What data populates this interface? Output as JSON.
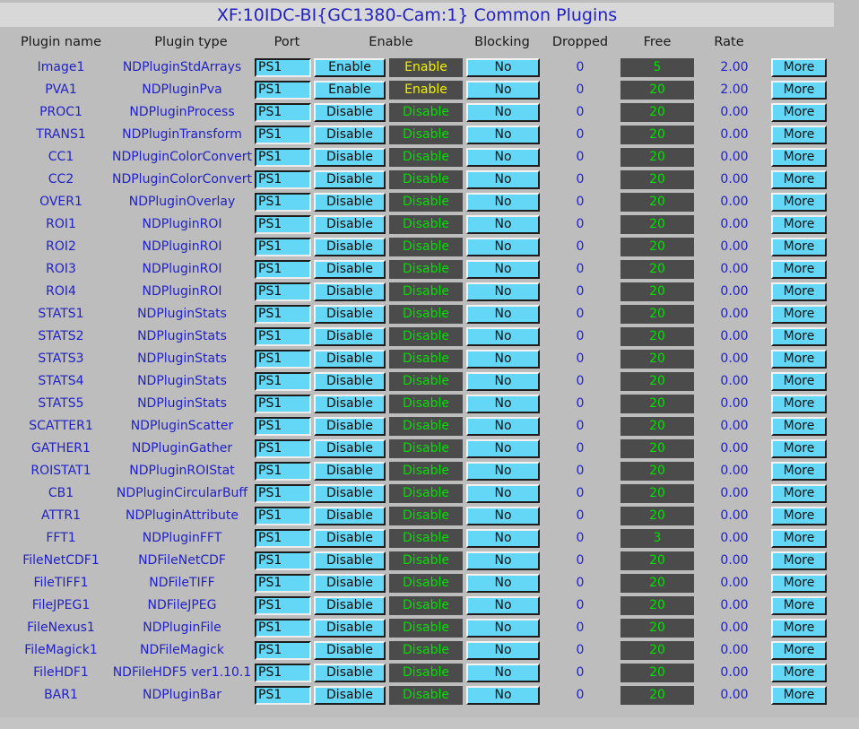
{
  "window": {
    "title": "XF:10IDC-BI{GC1380-Cam:1} Common Plugins",
    "bg_color": "#bdbdbd",
    "titlebar_color": "#d8d8d8",
    "title_color": "#2222c4"
  },
  "colors": {
    "label_blue": "#2222c4",
    "widget_cyan": "#63d7f5",
    "monitor_bg": "#4b4b4b",
    "monitor_green": "#00e000",
    "monitor_yellow": "#f2f200"
  },
  "table": {
    "headers": [
      "Plugin name",
      "Plugin type",
      "Port",
      "Enable",
      "Blocking",
      "Dropped",
      "Free",
      "Rate"
    ],
    "more_label": "More",
    "rows": [
      {
        "name": "Image1",
        "type": "NDPluginStdArrays",
        "port": "PS1",
        "enable_button": "Enable",
        "enable_readback": "Enable",
        "enable_state": "enabled",
        "blocking": "No",
        "dropped": "0",
        "free": "5",
        "rate": "2.00",
        "more": "More"
      },
      {
        "name": "PVA1",
        "type": "NDPluginPva",
        "port": "PS1",
        "enable_button": "Enable",
        "enable_readback": "Enable",
        "enable_state": "enabled",
        "blocking": "No",
        "dropped": "0",
        "free": "20",
        "rate": "2.00",
        "more": "More"
      },
      {
        "name": "PROC1",
        "type": "NDPluginProcess",
        "port": "PS1",
        "enable_button": "Disable",
        "enable_readback": "Disable",
        "enable_state": "disabled",
        "blocking": "No",
        "dropped": "0",
        "free": "20",
        "rate": "0.00",
        "more": "More"
      },
      {
        "name": "TRANS1",
        "type": "NDPluginTransform",
        "port": "PS1",
        "enable_button": "Disable",
        "enable_readback": "Disable",
        "enable_state": "disabled",
        "blocking": "No",
        "dropped": "0",
        "free": "20",
        "rate": "0.00",
        "more": "More"
      },
      {
        "name": "CC1",
        "type": "NDPluginColorConvert",
        "port": "PS1",
        "enable_button": "Disable",
        "enable_readback": "Disable",
        "enable_state": "disabled",
        "blocking": "No",
        "dropped": "0",
        "free": "20",
        "rate": "0.00",
        "more": "More"
      },
      {
        "name": "CC2",
        "type": "NDPluginColorConvert",
        "port": "PS1",
        "enable_button": "Disable",
        "enable_readback": "Disable",
        "enable_state": "disabled",
        "blocking": "No",
        "dropped": "0",
        "free": "20",
        "rate": "0.00",
        "more": "More"
      },
      {
        "name": "OVER1",
        "type": "NDPluginOverlay",
        "port": "PS1",
        "enable_button": "Disable",
        "enable_readback": "Disable",
        "enable_state": "disabled",
        "blocking": "No",
        "dropped": "0",
        "free": "20",
        "rate": "0.00",
        "more": "More"
      },
      {
        "name": "ROI1",
        "type": "NDPluginROI",
        "port": "PS1",
        "enable_button": "Disable",
        "enable_readback": "Disable",
        "enable_state": "disabled",
        "blocking": "No",
        "dropped": "0",
        "free": "20",
        "rate": "0.00",
        "more": "More"
      },
      {
        "name": "ROI2",
        "type": "NDPluginROI",
        "port": "PS1",
        "enable_button": "Disable",
        "enable_readback": "Disable",
        "enable_state": "disabled",
        "blocking": "No",
        "dropped": "0",
        "free": "20",
        "rate": "0.00",
        "more": "More"
      },
      {
        "name": "ROI3",
        "type": "NDPluginROI",
        "port": "PS1",
        "enable_button": "Disable",
        "enable_readback": "Disable",
        "enable_state": "disabled",
        "blocking": "No",
        "dropped": "0",
        "free": "20",
        "rate": "0.00",
        "more": "More"
      },
      {
        "name": "ROI4",
        "type": "NDPluginROI",
        "port": "PS1",
        "enable_button": "Disable",
        "enable_readback": "Disable",
        "enable_state": "disabled",
        "blocking": "No",
        "dropped": "0",
        "free": "20",
        "rate": "0.00",
        "more": "More"
      },
      {
        "name": "STATS1",
        "type": "NDPluginStats",
        "port": "PS1",
        "enable_button": "Disable",
        "enable_readback": "Disable",
        "enable_state": "disabled",
        "blocking": "No",
        "dropped": "0",
        "free": "20",
        "rate": "0.00",
        "more": "More"
      },
      {
        "name": "STATS2",
        "type": "NDPluginStats",
        "port": "PS1",
        "enable_button": "Disable",
        "enable_readback": "Disable",
        "enable_state": "disabled",
        "blocking": "No",
        "dropped": "0",
        "free": "20",
        "rate": "0.00",
        "more": "More"
      },
      {
        "name": "STATS3",
        "type": "NDPluginStats",
        "port": "PS1",
        "enable_button": "Disable",
        "enable_readback": "Disable",
        "enable_state": "disabled",
        "blocking": "No",
        "dropped": "0",
        "free": "20",
        "rate": "0.00",
        "more": "More"
      },
      {
        "name": "STATS4",
        "type": "NDPluginStats",
        "port": "PS1",
        "enable_button": "Disable",
        "enable_readback": "Disable",
        "enable_state": "disabled",
        "blocking": "No",
        "dropped": "0",
        "free": "20",
        "rate": "0.00",
        "more": "More"
      },
      {
        "name": "STATS5",
        "type": "NDPluginStats",
        "port": "PS1",
        "enable_button": "Disable",
        "enable_readback": "Disable",
        "enable_state": "disabled",
        "blocking": "No",
        "dropped": "0",
        "free": "20",
        "rate": "0.00",
        "more": "More"
      },
      {
        "name": "SCATTER1",
        "type": "NDPluginScatter",
        "port": "PS1",
        "enable_button": "Disable",
        "enable_readback": "Disable",
        "enable_state": "disabled",
        "blocking": "No",
        "dropped": "0",
        "free": "20",
        "rate": "0.00",
        "more": "More"
      },
      {
        "name": "GATHER1",
        "type": "NDPluginGather",
        "port": "PS1",
        "enable_button": "Disable",
        "enable_readback": "Disable",
        "enable_state": "disabled",
        "blocking": "No",
        "dropped": "0",
        "free": "20",
        "rate": "0.00",
        "more": "More"
      },
      {
        "name": "ROISTAT1",
        "type": "NDPluginROIStat",
        "port": "PS1",
        "enable_button": "Disable",
        "enable_readback": "Disable",
        "enable_state": "disabled",
        "blocking": "No",
        "dropped": "0",
        "free": "20",
        "rate": "0.00",
        "more": "More"
      },
      {
        "name": "CB1",
        "type": "NDPluginCircularBuff",
        "port": "PS1",
        "enable_button": "Disable",
        "enable_readback": "Disable",
        "enable_state": "disabled",
        "blocking": "No",
        "dropped": "0",
        "free": "20",
        "rate": "0.00",
        "more": "More"
      },
      {
        "name": "ATTR1",
        "type": "NDPluginAttribute",
        "port": "PS1",
        "enable_button": "Disable",
        "enable_readback": "Disable",
        "enable_state": "disabled",
        "blocking": "No",
        "dropped": "0",
        "free": "20",
        "rate": "0.00",
        "more": "More"
      },
      {
        "name": "FFT1",
        "type": "NDPluginFFT",
        "port": "PS1",
        "enable_button": "Disable",
        "enable_readback": "Disable",
        "enable_state": "disabled",
        "blocking": "No",
        "dropped": "0",
        "free": "3",
        "rate": "0.00",
        "more": "More"
      },
      {
        "name": "FileNetCDF1",
        "type": "NDFileNetCDF",
        "port": "PS1",
        "enable_button": "Disable",
        "enable_readback": "Disable",
        "enable_state": "disabled",
        "blocking": "No",
        "dropped": "0",
        "free": "20",
        "rate": "0.00",
        "more": "More"
      },
      {
        "name": "FileTIFF1",
        "type": "NDFileTIFF",
        "port": "PS1",
        "enable_button": "Disable",
        "enable_readback": "Disable",
        "enable_state": "disabled",
        "blocking": "No",
        "dropped": "0",
        "free": "20",
        "rate": "0.00",
        "more": "More"
      },
      {
        "name": "FileJPEG1",
        "type": "NDFileJPEG",
        "port": "PS1",
        "enable_button": "Disable",
        "enable_readback": "Disable",
        "enable_state": "disabled",
        "blocking": "No",
        "dropped": "0",
        "free": "20",
        "rate": "0.00",
        "more": "More"
      },
      {
        "name": "FileNexus1",
        "type": "NDPluginFile",
        "port": "PS1",
        "enable_button": "Disable",
        "enable_readback": "Disable",
        "enable_state": "disabled",
        "blocking": "No",
        "dropped": "0",
        "free": "20",
        "rate": "0.00",
        "more": "More"
      },
      {
        "name": "FileMagick1",
        "type": "NDFileMagick",
        "port": "PS1",
        "enable_button": "Disable",
        "enable_readback": "Disable",
        "enable_state": "disabled",
        "blocking": "No",
        "dropped": "0",
        "free": "20",
        "rate": "0.00",
        "more": "More"
      },
      {
        "name": "FileHDF1",
        "type": "NDFileHDF5 ver1.10.1",
        "port": "PS1",
        "enable_button": "Disable",
        "enable_readback": "Disable",
        "enable_state": "disabled",
        "blocking": "No",
        "dropped": "0",
        "free": "20",
        "rate": "0.00",
        "more": "More"
      },
      {
        "name": "BAR1",
        "type": "NDPluginBar",
        "port": "PS1",
        "enable_button": "Disable",
        "enable_readback": "Disable",
        "enable_state": "disabled",
        "blocking": "No",
        "dropped": "0",
        "free": "20",
        "rate": "0.00",
        "more": "More"
      }
    ]
  }
}
